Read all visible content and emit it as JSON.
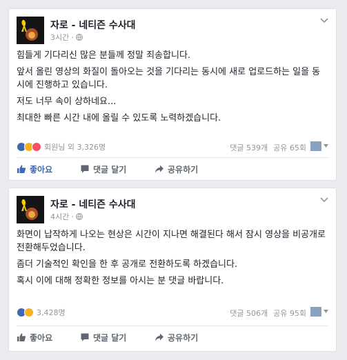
{
  "posts": [
    {
      "page_name": "자로 - 네티즌 수사대",
      "time": "3시간",
      "body": [
        "힘들게 기다리신 많은 분들께 정말 죄송합니다.",
        "앞서 올린 영상의 화질이 돌아오는 것을 기다리는 동시에 새로 업로드하는 일을 동시에 진행하고 있습니다.",
        "저도 너무 속이 상하네요...",
        "최대한 빠른 시간 내에 올릴 수 있도록 노력하겠습니다."
      ],
      "reactions_text": "회원님 외 3,326명",
      "comments": "댓글 539개",
      "shares": "공유 65회",
      "actions": {
        "like": "좋아요",
        "comment": "댓글 달기",
        "share": "공유하기"
      },
      "like_active": true
    },
    {
      "page_name": "자로 - 네티즌 수사대",
      "time": "4시간",
      "body": [
        "화면이 납작하게 나오는 현상은 시간이 지나면 해결된다 해서 잠시 영상을 비공개로 전환해두었습니다.",
        "좀더 기술적인 확인을 한 후 공개로 전환하도록 하겠습니다.",
        "혹시 이에 대해 정확한 정보를 아시는 분 댓글 바랍니다."
      ],
      "reactions_text": "3,428명",
      "comments": "댓글 506개",
      "shares": "공유 95회",
      "actions": {
        "like": "좋아요",
        "comment": "댓글 달기",
        "share": "공유하기"
      },
      "like_active": false
    }
  ],
  "colors": {
    "link_blue": "#4267b2",
    "like_reaction": "#4267b2",
    "sad_reaction": "#f7b125",
    "love_reaction": "#f25268",
    "meta_gray": "#90949c"
  },
  "icons": {
    "avatar": "ribbon-on-dark-avatar-icon",
    "privacy": "globe-icon",
    "menu": "chevron-down-icon",
    "like": "thumbs-up-icon",
    "comment": "comment-bubble-icon",
    "share": "share-arrow-icon"
  }
}
